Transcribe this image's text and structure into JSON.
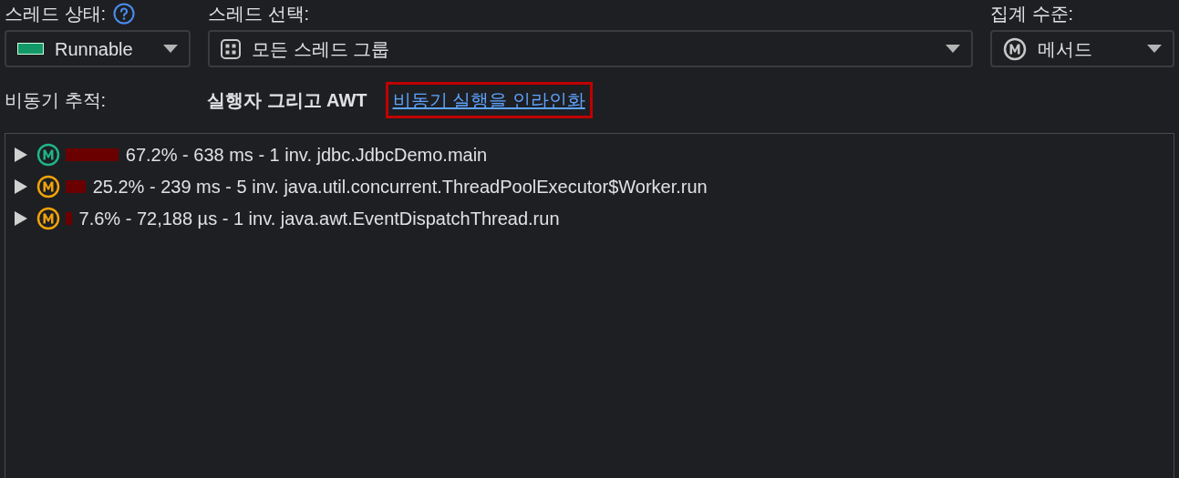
{
  "thread_status": {
    "label": "스레드 상태:",
    "value": "Runnable",
    "color": "#13986a"
  },
  "thread_select": {
    "label": "스레드 선택:",
    "value": "모든 스레드 그룹"
  },
  "aggregation": {
    "label": "집계 수준:",
    "value": "메서드"
  },
  "async": {
    "label": "비동기 추적:",
    "value": "실행자 그리고 AWT",
    "link": {
      "text": "비동기 실행을 인라인화",
      "highlighted": true
    }
  },
  "tree": [
    {
      "expanded": false,
      "color": "#1fb584",
      "text": "67.2% - 638 ms - 1 inv. jdbc.JdbcDemo.main"
    },
    {
      "expanded": false,
      "color": "#f0a30a",
      "text": "25.2% - 239 ms - 5 inv. java.util.concurrent.ThreadPoolExecutor$Worker.run"
    },
    {
      "expanded": false,
      "color": "#f0a30a",
      "text": "7.6% - 72,188 µs - 1 inv. java.awt.EventDispatchThread.run"
    }
  ]
}
